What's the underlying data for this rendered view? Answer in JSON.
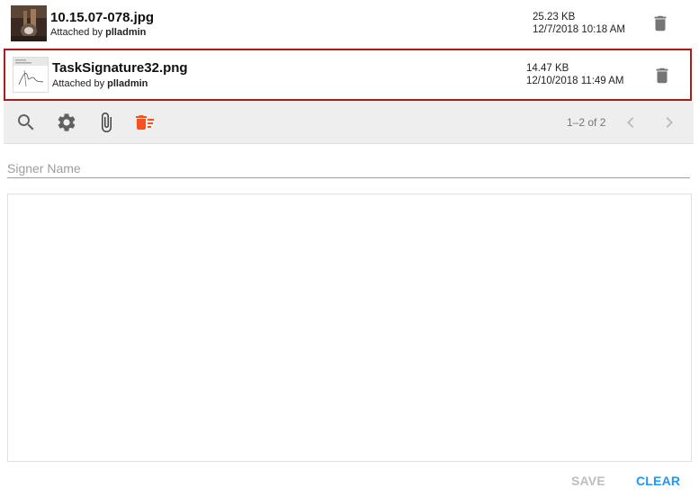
{
  "attachments": [
    {
      "file_name": "10.15.07-078.jpg",
      "attached_prefix": "Attached by",
      "attached_by": "plladmin",
      "size": "25.23 KB",
      "date": "12/7/2018 10:18 AM",
      "delete_icon": "trash-icon"
    },
    {
      "file_name": "TaskSignature32.png",
      "attached_prefix": "Attached by",
      "attached_by": "plladmin",
      "size": "14.47 KB",
      "date": "12/10/2018 11:49 AM",
      "delete_icon": "trash-icon"
    }
  ],
  "toolbar": {
    "icons": [
      "search-icon",
      "gear-icon",
      "paperclip-icon",
      "delete-sweep-icon"
    ],
    "pager": "1–2 of 2",
    "accent_color": "#f4511e"
  },
  "signer": {
    "placeholder": "Signer Name",
    "value": ""
  },
  "actions": {
    "save_label": "SAVE",
    "clear_label": "CLEAR",
    "clear_color": "#2196f3"
  },
  "selection_color": "#a91c1c"
}
